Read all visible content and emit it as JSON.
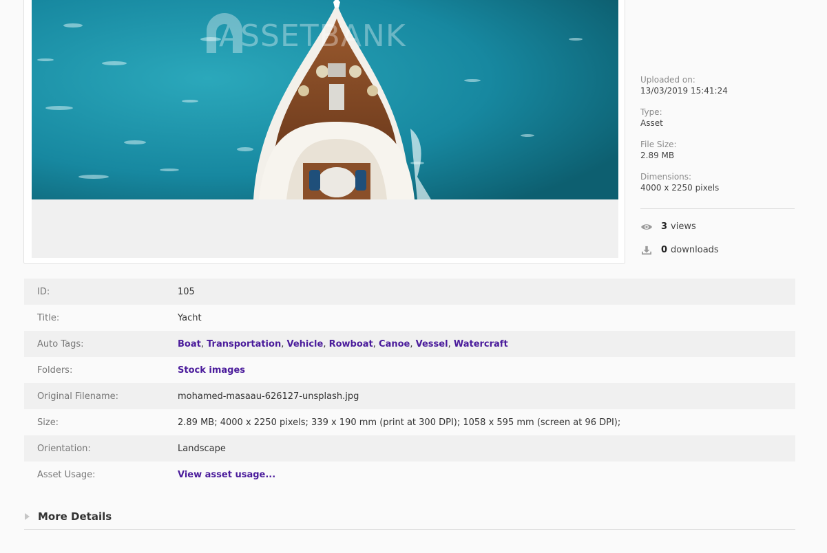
{
  "watermark": {
    "text": "ASSETBANK"
  },
  "info": {
    "uploaded_label": "Uploaded on:",
    "uploaded_value": "13/03/2019 15:41:24",
    "type_label": "Type:",
    "type_value": "Asset",
    "filesize_label": "File Size:",
    "filesize_value": "2.89 MB",
    "dimensions_label": "Dimensions:",
    "dimensions_value": "4000 x 2250 pixels",
    "views_count": "3",
    "views_label": "views",
    "downloads_count": "0",
    "downloads_label": "downloads",
    "views_icon": "eye-icon",
    "downloads_icon": "download-icon"
  },
  "details": {
    "id_label": "ID:",
    "id_value": "105",
    "title_label": "Title:",
    "title_value": "Yacht",
    "tags_label": "Auto Tags:",
    "tags": [
      "Boat",
      "Transportation",
      "Vehicle",
      "Rowboat",
      "Canoe",
      "Vessel",
      "Watercraft"
    ],
    "folders_label": "Folders:",
    "folders_value": "Stock images",
    "filename_label": "Original Filename:",
    "filename_value": "mohamed-masaau-626127-unsplash.jpg",
    "size_label": "Size:",
    "size_value": "2.89 MB; 4000 x 2250 pixels; 339 x 190 mm (print at 300 DPI); 1058 x 595 mm (screen at 96 DPI);",
    "orientation_label": "Orientation:",
    "orientation_value": "Landscape",
    "usage_label": "Asset Usage:",
    "usage_value": "View asset usage..."
  },
  "more_details": {
    "label": "More Details",
    "icon": "triangle-right-icon"
  },
  "colors": {
    "link": "#4a1b9b",
    "row_alt": "#f0f0f0",
    "water": "#1a9bb0"
  }
}
